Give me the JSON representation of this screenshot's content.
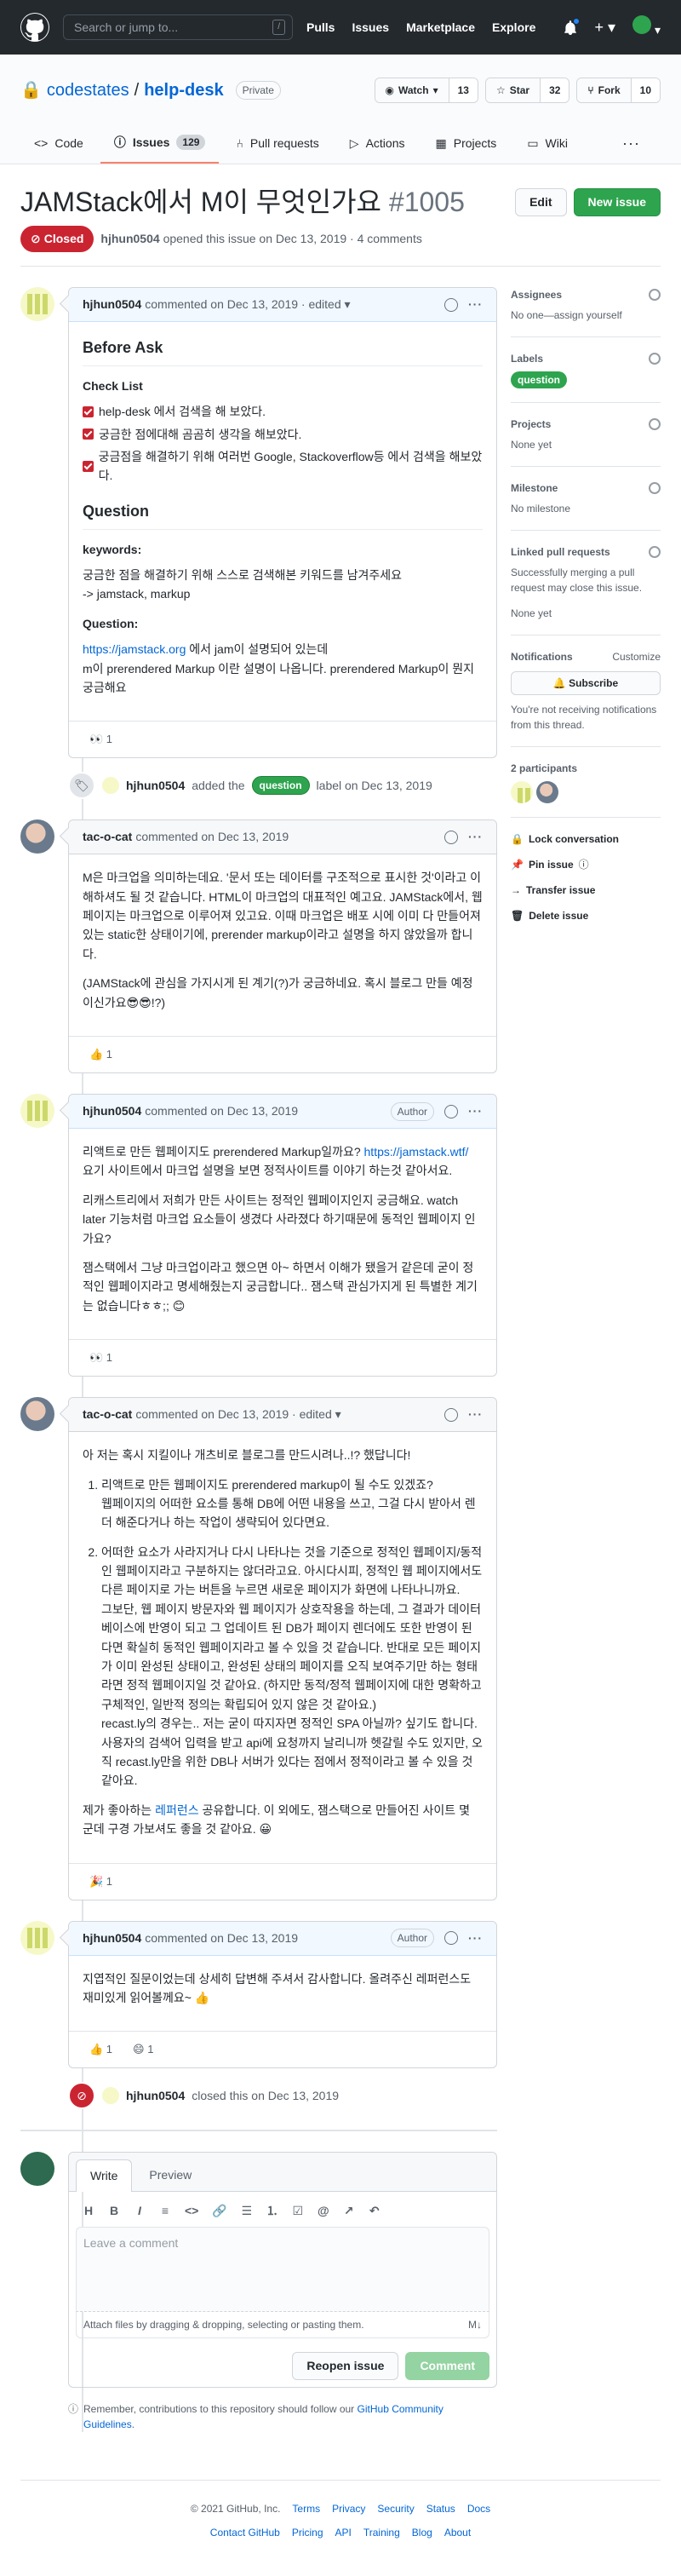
{
  "header": {
    "search_placeholder": "Search or jump to...",
    "search_key": "/",
    "nav": [
      "Pulls",
      "Issues",
      "Marketplace",
      "Explore"
    ]
  },
  "repo": {
    "owner": "codestates",
    "sep": "/",
    "name": "help-desk",
    "visibility": "Private",
    "watch": {
      "label": "Watch",
      "count": "13"
    },
    "star": {
      "label": "Star",
      "count": "32"
    },
    "fork": {
      "label": "Fork",
      "count": "10"
    }
  },
  "tabs": [
    {
      "label": "Code"
    },
    {
      "label": "Issues",
      "count": "129"
    },
    {
      "label": "Pull requests"
    },
    {
      "label": "Actions"
    },
    {
      "label": "Projects"
    },
    {
      "label": "Wiki"
    }
  ],
  "issue": {
    "title": "JAMStack에서 M이 무엇인가요",
    "number": "#1005",
    "edit": "Edit",
    "new_issue": "New issue",
    "state": "Closed",
    "author": "hjhun0504",
    "opened": "opened this issue on Dec 13, 2019 · 4 comments"
  },
  "comments": [
    {
      "author": "hjhun0504",
      "meta": "commented on Dec 13, 2019 · edited ▾",
      "h2a": "Before Ask",
      "h3a": "Check List",
      "checks": [
        "help-desk 에서 검색을 해 보았다.",
        "궁금한 점에대해 곰곰히 생각을 해보았다.",
        "궁금점을 해결하기 위해 여러번 Google, Stackoverflow등 에서 검색을 해보았다."
      ],
      "h2b": "Question",
      "h3b": "keywords:",
      "kw1": "궁금한 점을 해결하기 위해 스스로 검색해본 키워드를 남겨주세요",
      "kw2": "-> jamstack, markup",
      "h3c": "Question:",
      "link": "https://jamstack.org",
      "q1": " 에서 jam이 설명되어 있는데",
      "q2": "m이 prerendered Markup 이란 설명이 나옵니다. prerendered Markup이 뭔지 궁금해요",
      "reaction": "👀 1"
    },
    {
      "author": "tac-o-cat",
      "meta": "commented on Dec 13, 2019",
      "p1": "M은 마크업을 의미하는데요. '문서 또는 데이터를 구조적으로 표시한 것'이라고 이해하셔도 될 것 같습니다. HTML이 마크업의 대표적인 예고요. JAMStack에서, 웹페이지는 마크업으로 이루어져 있고요. 이때 마크업은 배포 시에 이미 다 만들어져 있는 static한 상태이기에, prerender markup이라고 설명을 하지 않았을까 합니다.",
      "p2": "(JAMStack에 관심을 가지시게 된 계기(?)가 궁금하네요. 혹시 블로그 만들 예정이신가요😎😎!?)",
      "reaction": "👍 1"
    },
    {
      "author": "hjhun0504",
      "meta": "commented on Dec 13, 2019",
      "badge": "Author",
      "p1a": "리액트로 만든 웹페이지도 prerendered Markup일까요? ",
      "link": "https://jamstack.wtf/",
      "p1b": " 요기 사이트에서 마크업 설명을 보면 정적사이트를 이야기 하는것 같아서요.",
      "p2": "리캐스트리에서 저희가 만든 사이트는 정적인 웹페이지인지 궁금해요. watch later 기능처럼 마크업 요소들이 생겼다 사라졌다 하기때문에 동적인 웹페이지 인가요?",
      "p3": "잼스택에서 그냥 마크업이라고 했으면 아~ 하면서 이해가 됐을거 같은데 굳이 정적인 웹페이지라고 명세해줬는지 궁금합니다.. 잼스택 관심가지게 된 특별한 계기는 없습니다ㅎㅎ;; 😊",
      "reaction": "👀 1"
    },
    {
      "author": "tac-o-cat",
      "meta": "commented on Dec 13, 2019 · edited ▾",
      "p1": "아 저는 혹시 지킬이나 개츠비로 블로그를 만드시려나..!? 했답니다!",
      "li1a": "리액트로 만든 웹페이지도 prerendered markup이 될 수도 있겠죠?",
      "li1b": "웹페이지의 어떠한 요소를 통해 DB에 어떤 내용을 쓰고, 그걸 다시 받아서 렌더 해준다거나 하는 작업이 생략되어 있다면요.",
      "li2a": "어떠한 요소가 사라지거나 다시 나타나는 것을 기준으로 정적인 웹페이지/동적인 웹페이지라고 구분하지는 않더라고요. 아시다시피, 정적인 웹 페이지에서도 다른 페이지로 가는 버튼을 누르면 새로운 페이지가 화면에 나타나니까요.",
      "li2b": "그보단, 웹 페이지 방문자와 웹 페이지가 상호작용을 하는데, 그 결과가 데이터베이스에 반영이 되고 그 업데이트 된 DB가 페이지 렌더에도 또한 반영이 된다면 확실히 동적인 웹페이지라고 볼 수 있을 것 같습니다. 반대로 모든 페이지가 이미 완성된 상태이고, 완성된 상태의 페이지를 오직 보여주기만 하는 형태라면 정적 웹페이지일 것 같아요. (하지만 동적/정적 웹페이지에 대한 명확하고 구체적인, 일반적 정의는 확립되어 있지 않은 것 같아요.)",
      "li2c": "recast.ly의 경우는.. 저는 굳이 따지자면 정적인 SPA 아닐까? 싶기도 합니다. 사용자의 검색어 입력을 받고 api에 요청까지 날리니까 헷갈릴 수도 있지만, 오직 recast.ly만을 위한 DB나 서버가 있다는 점에서 정적이라고 볼 수 있을 것 같아요.",
      "p2a": "제가 좋아하는 ",
      "link": "레퍼런스",
      "p2b": " 공유합니다. 이 외에도, 잼스택으로 만들어진 사이트 몇 군데 구경 가보셔도 좋을 것 같아요. 😀",
      "reaction": "🎉 1"
    },
    {
      "author": "hjhun0504",
      "meta": "commented on Dec 13, 2019",
      "badge": "Author",
      "p1": "지엽적인 질문이었는데 상세히 답변해 주셔서 감사합니다. 올려주신 레퍼런스도 재미있게 읽어볼께요~ 👍",
      "reaction1": "👍 1",
      "reaction2": "😄 1"
    }
  ],
  "events": {
    "labeled": {
      "author": "hjhun0504",
      "pre": "added the",
      "label": "question",
      "post": "label on Dec 13, 2019"
    },
    "closed": {
      "author": "hjhun0504",
      "text": "closed this on Dec 13, 2019"
    }
  },
  "new_comment": {
    "tab_write": "Write",
    "tab_preview": "Preview",
    "placeholder": "Leave a comment",
    "attach": "Attach files by dragging & dropping, selecting or pasting them.",
    "reopen": "Reopen issue",
    "comment": "Comment",
    "remind_pre": "Remember, contributions to this repository should follow our ",
    "remind_link": "GitHub Community Guidelines",
    "remind_post": "."
  },
  "sidebar": {
    "assignees": "Assignees",
    "assignees_val": "No one—assign yourself",
    "labels": "Labels",
    "label_val": "question",
    "projects": "Projects",
    "projects_val": "None yet",
    "milestone": "Milestone",
    "milestone_val": "No milestone",
    "linked": "Linked pull requests",
    "linked_desc": "Successfully merging a pull request may close this issue.",
    "linked_val": "None yet",
    "notif": "Notifications",
    "customize": "Customize",
    "subscribe": "🔔 Subscribe",
    "notif_desc": "You're not receiving notifications from this thread.",
    "participants": "2 participants",
    "actions": [
      "Lock conversation",
      "Pin issue",
      "Transfer issue",
      "Delete issue"
    ]
  },
  "footer": {
    "copy": "© 2021 GitHub, Inc.",
    "row1": [
      "Terms",
      "Privacy",
      "Security",
      "Status",
      "Docs"
    ],
    "row2": [
      "Contact GitHub",
      "Pricing",
      "API",
      "Training",
      "Blog",
      "About"
    ]
  }
}
